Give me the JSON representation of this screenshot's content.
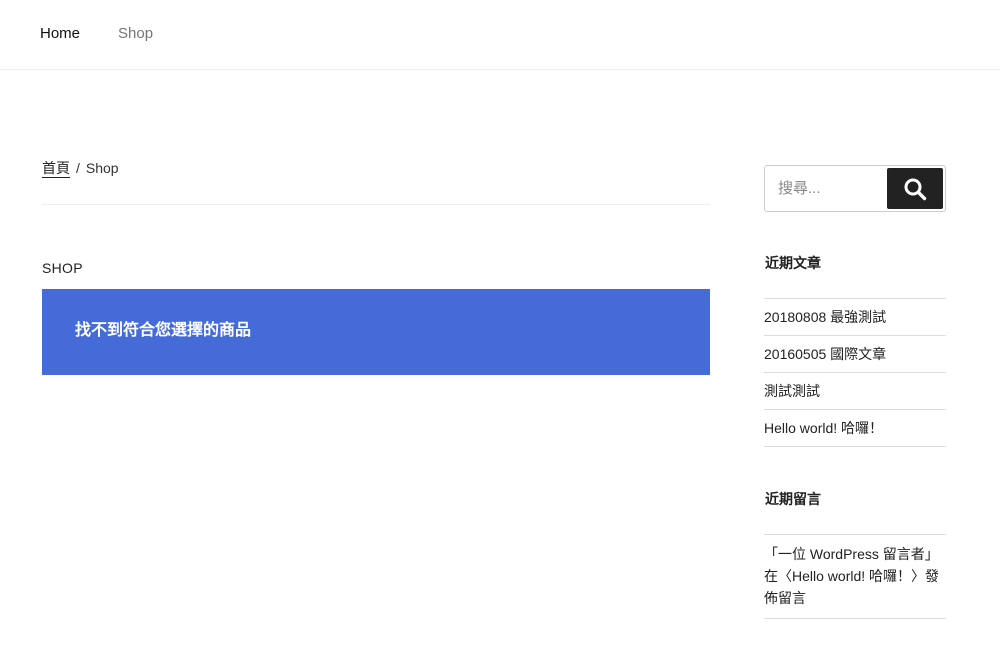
{
  "nav": {
    "home": "Home",
    "shop": "Shop"
  },
  "breadcrumb": {
    "home": "首頁",
    "separator": "/",
    "current": "Shop"
  },
  "main": {
    "title": "SHOP",
    "notice": "找不到符合您選擇的商品",
    "notice_color": "#456bd8"
  },
  "search": {
    "placeholder": "搜尋...",
    "icon": "search-icon"
  },
  "sidebar": {
    "recent_posts_title": "近期文章",
    "recent_posts": [
      "20180808 最強測試",
      "20160505 國際文章",
      "測試測試",
      "Hello world! 哈囉！"
    ],
    "recent_comments_title": "近期留言",
    "recent_comments": {
      "author": "「一位 WordPress 留言者」",
      "text_in": "在〈",
      "post": "Hello world! 哈囉！",
      "text_after": "〉發佈留言"
    }
  }
}
